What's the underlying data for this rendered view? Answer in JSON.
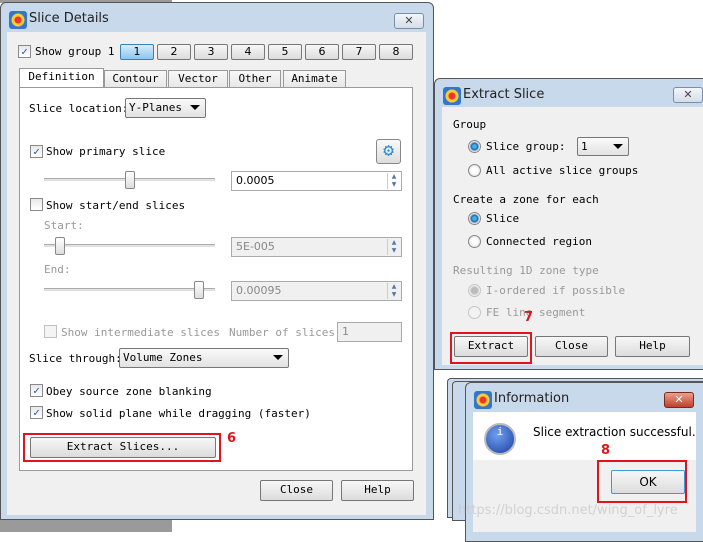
{
  "slice_details": {
    "title": "Slice Details",
    "show_group_label": "Show group 1",
    "show_group_checked": true,
    "groups": [
      "1",
      "2",
      "3",
      "4",
      "5",
      "6",
      "7",
      "8"
    ],
    "active_group": "1",
    "tabs": [
      "Definition",
      "Contour",
      "Vector",
      "Other",
      "Animate"
    ],
    "active_tab": "Definition",
    "slice_location_label": "Slice location:",
    "slice_location_value": "Y-Planes",
    "show_primary_label": "Show primary slice",
    "show_primary_checked": true,
    "primary_value": "0.0005",
    "primary_slider_fraction": 0.5,
    "show_start_end_label": "Show start/end slices",
    "show_start_end_checked": false,
    "start_label": "Start:",
    "start_value": "5E-005",
    "start_slider_fraction": 0.05,
    "end_label": "End:",
    "end_value": "0.00095",
    "end_slider_fraction": 0.95,
    "show_intermediate_label": "Show intermediate slices",
    "num_slices_label": "Number of slices:",
    "num_slices_value": "1",
    "slice_through_label": "Slice through:",
    "slice_through_value": "Volume Zones",
    "obey_blanking_label": "Obey source zone blanking",
    "show_solid_label": "Show solid plane while dragging (faster)",
    "extract_slices_label": "Extract Slices...",
    "close_label": "Close",
    "help_label": "Help",
    "step_marker": "6"
  },
  "extract_slice": {
    "title": "Extract Slice",
    "group_heading": "Group",
    "slice_group_label": "Slice group:",
    "slice_group_value": "1",
    "all_active_label": "All active slice groups",
    "create_zone_heading": "Create a zone for each",
    "slice_label": "Slice",
    "connected_label": "Connected region",
    "resulting_heading": "Resulting 1D zone type",
    "i_ordered_label": "I-ordered if possible",
    "fe_line_label": "FE line segment",
    "extract_label": "Extract",
    "close_label": "Close",
    "help_label": "Help",
    "step_marker": "7"
  },
  "information": {
    "title": "Information",
    "message": "Slice extraction successful.",
    "ok_label": "OK",
    "step_marker": "8"
  },
  "watermark": "https://blog.csdn.net/wing_of_lyre"
}
